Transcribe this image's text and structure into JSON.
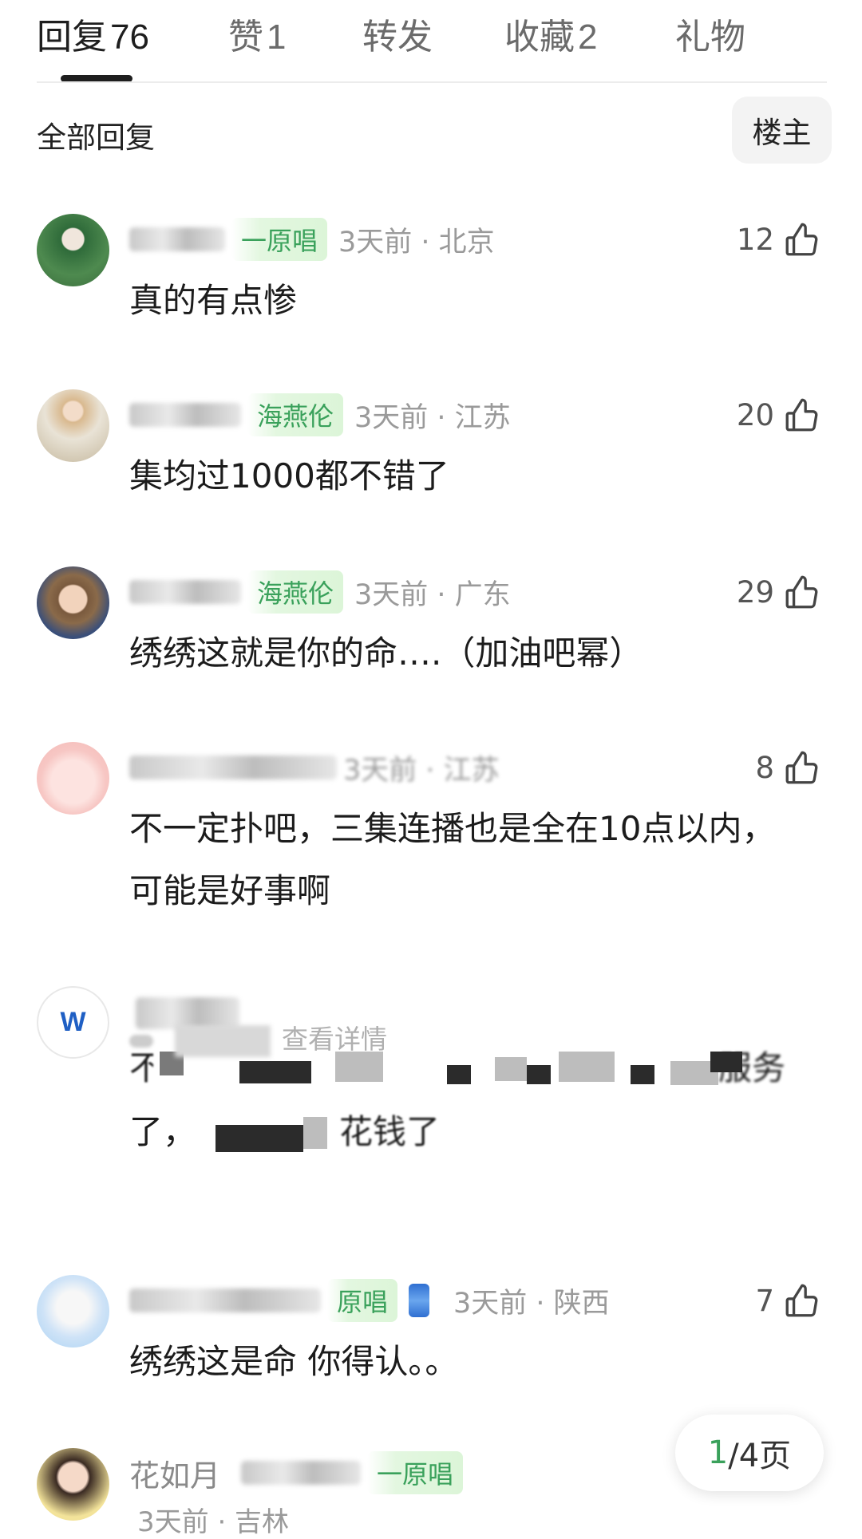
{
  "tabs": [
    {
      "label": "回复",
      "count": "76",
      "active": true
    },
    {
      "label": "赞",
      "count": "1",
      "active": false
    },
    {
      "label": "转发",
      "count": "",
      "active": false
    },
    {
      "label": "收藏",
      "count": "2",
      "active": false
    },
    {
      "label": "礼物",
      "count": "",
      "active": false
    }
  ],
  "filter": {
    "label": "全部回复",
    "host_button": "楼主"
  },
  "comments": [
    {
      "tag": "一原唱",
      "time": "3天前 · 北京",
      "likes": "12",
      "text": "真的有点惨"
    },
    {
      "tag": "海燕伦",
      "time": "3天前 · 江苏",
      "likes": "20",
      "text": "集均过1000都不错了"
    },
    {
      "tag": "海燕伦",
      "time": "3天前 · 广东",
      "likes": "29",
      "text": "绣绣这就是你的命….（加油吧幂）"
    },
    {
      "tag": "",
      "time": "3天前 · 江苏",
      "likes": "8",
      "text": "不一定扑吧，三集连播也是全在10点以内，可能是好事啊"
    },
    {
      "text_start": "不能再",
      "text_end": "服务",
      "text_line2_start": "了，",
      "text_line2_end": "花钱了",
      "ad_link": "查看详情"
    },
    {
      "tag": "原唱",
      "time": "3天前 · 陕西",
      "likes": "7",
      "text": "绣绣这是命 你得认。。"
    },
    {
      "name": "花如月",
      "tag": "一原唱",
      "time": "3天前 · 吉林"
    }
  ],
  "pagination": {
    "current": "1",
    "total": "/4页"
  },
  "colors": {
    "accent_green": "#3aa15b",
    "tag_bg": "#e3f7e0",
    "muted": "#9a9a9a"
  }
}
